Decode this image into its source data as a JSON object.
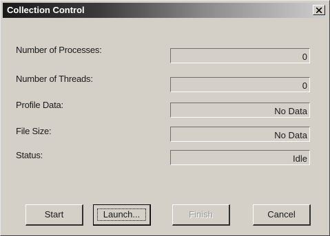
{
  "window": {
    "title": "Collection Control",
    "close_icon": "close-icon"
  },
  "rows": [
    {
      "label": "Number of Processes:",
      "value": "0"
    },
    {
      "label": "Number of Threads:",
      "value": "0"
    },
    {
      "label": "Profile Data:",
      "value": "No Data"
    },
    {
      "label": "File Size:",
      "value": "No Data"
    },
    {
      "label": "Status:",
      "value": "Idle"
    }
  ],
  "buttons": {
    "start": "Start",
    "launch": "Launch...",
    "finish": "Finish",
    "cancel": "Cancel"
  },
  "colors": {
    "dialog_face": "#d4d0c8",
    "titlebar_start": "#1a1a1a",
    "titlebar_end": "#cfcfcf"
  }
}
